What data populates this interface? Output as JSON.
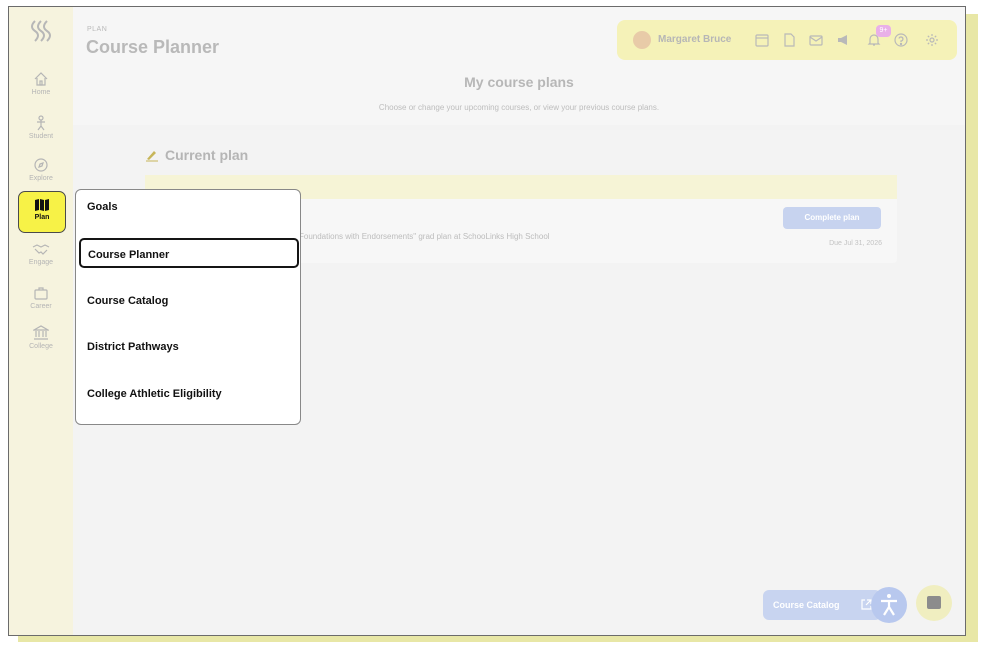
{
  "header": {
    "eyebrow": "PLAN",
    "title": "Course Planner"
  },
  "user": {
    "name": "Margaret Bruce",
    "notification_badge": "9+"
  },
  "sidebar": {
    "items": [
      {
        "label": "Home"
      },
      {
        "label": "Student"
      },
      {
        "label": "Explore"
      },
      {
        "label": "Plan"
      },
      {
        "label": "Engage"
      },
      {
        "label": "Career"
      },
      {
        "label": "College"
      }
    ]
  },
  "main": {
    "heading": "My course plans",
    "subheading": "Choose or change your upcoming courses, or view your previous course plans.",
    "current_plan": {
      "heading": "Current plan",
      "text": "Foundations with Endorsements\" grad plan at SchooLinks High School",
      "button": "Complete plan",
      "due": "Due Jul 31, 2026"
    }
  },
  "menu": {
    "items": [
      {
        "label": "Goals"
      },
      {
        "label": "Course Planner"
      },
      {
        "label": "Course Catalog"
      },
      {
        "label": "District Pathways"
      },
      {
        "label": "College Athletic Eligibility"
      }
    ]
  },
  "footer": {
    "catalog_button": "Course Catalog"
  },
  "colors": {
    "accent": "#f7f247",
    "sidebar_bg": "#f6f3de",
    "button_blue": "#c7d3ef"
  }
}
